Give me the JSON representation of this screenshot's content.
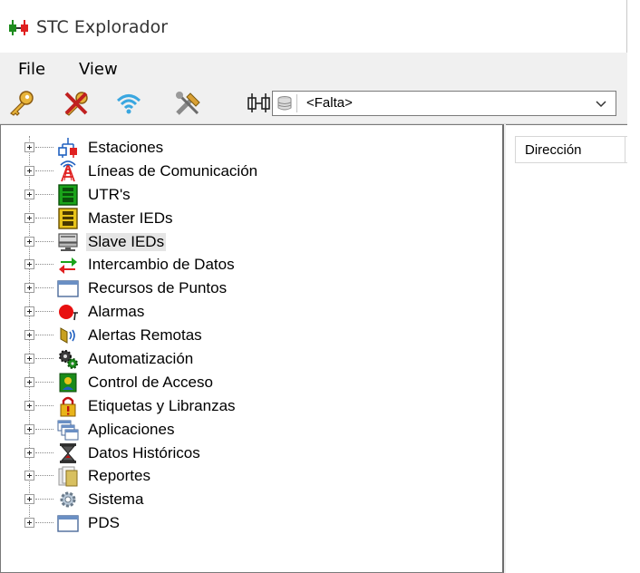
{
  "window": {
    "title": "STC Explorador"
  },
  "menubar": {
    "items": [
      {
        "label": "File"
      },
      {
        "label": "View"
      }
    ]
  },
  "toolbar": {
    "buttons": [
      {
        "icon": "key-icon"
      },
      {
        "icon": "key-cross-icon"
      },
      {
        "icon": "wifi-icon"
      },
      {
        "icon": "tools-icon"
      },
      {
        "icon": "network-icon"
      }
    ],
    "combo": {
      "value": "<Falta>",
      "icon": "database-icon"
    }
  },
  "list": {
    "columns": [
      {
        "label": "Dirección"
      }
    ]
  },
  "tree": {
    "items": [
      {
        "label": "Estaciones",
        "icon": "station-icon"
      },
      {
        "label": "Líneas de Comunicación",
        "icon": "tower-icon"
      },
      {
        "label": "UTR's",
        "icon": "rtu-icon"
      },
      {
        "label": "Master IEDs",
        "icon": "master-ied-icon"
      },
      {
        "label": "Slave IEDs",
        "icon": "slave-ied-icon",
        "selected": true
      },
      {
        "label": "Intercambio de Datos",
        "icon": "exchange-arrows-icon"
      },
      {
        "label": "Recursos de Puntos",
        "icon": "window-icon"
      },
      {
        "label": "Alarmas",
        "icon": "alarm-icon"
      },
      {
        "label": "Alertas Remotas",
        "icon": "remote-alert-icon"
      },
      {
        "label": "Automatización",
        "icon": "gears-icon"
      },
      {
        "label": "Control de Acceso",
        "icon": "access-control-icon"
      },
      {
        "label": "Etiquetas y Libranzas",
        "icon": "lock-tag-icon"
      },
      {
        "label": "Aplicaciones",
        "icon": "applications-icon"
      },
      {
        "label": "Datos Históricos",
        "icon": "hourglass-icon"
      },
      {
        "label": "Reportes",
        "icon": "reports-icon"
      },
      {
        "label": "Sistema",
        "icon": "system-gear-icon"
      },
      {
        "label": "PDS",
        "icon": "window-icon"
      }
    ]
  },
  "colors": {
    "accent_red": "#e02020",
    "accent_green": "#1e8c1e",
    "selection": "#e5e5e5"
  }
}
